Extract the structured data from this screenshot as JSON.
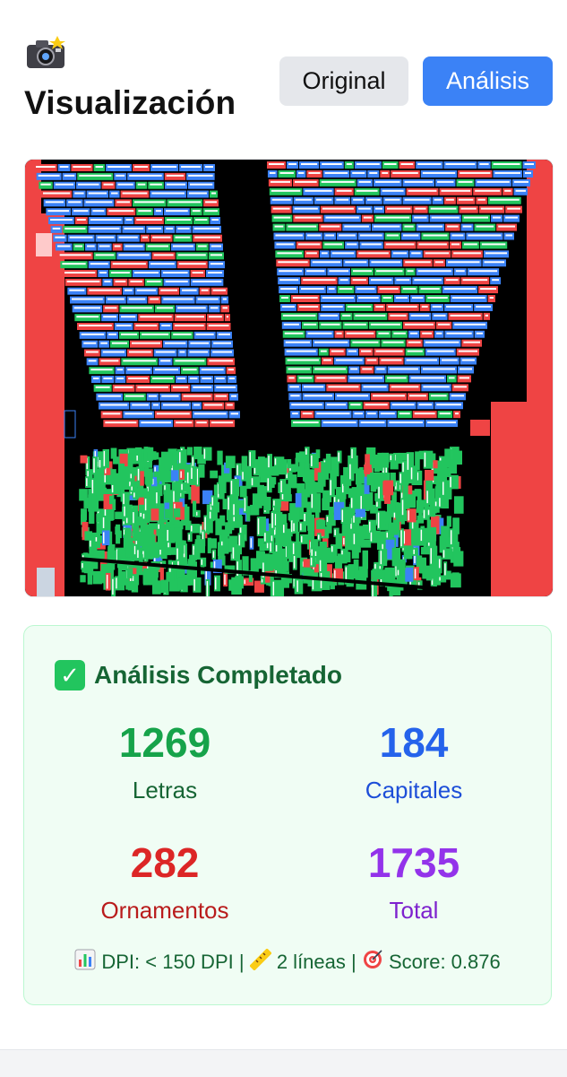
{
  "header": {
    "icon": "camera-flash-icon",
    "title": "Visualización",
    "buttons": {
      "original": "Original",
      "analisis": "Análisis"
    },
    "active_button": "analisis"
  },
  "visualization": {
    "colors": {
      "letters": "#22c55e",
      "capitals": "#3b82f6",
      "ornaments": "#ef4444",
      "background": "#000000"
    }
  },
  "result": {
    "icon": "check-icon",
    "title": "Análisis Completado",
    "stats": [
      {
        "value": "1269",
        "label": "Letras",
        "color": "#16a34a"
      },
      {
        "value": "184",
        "label": "Capitales",
        "color": "#2563eb"
      },
      {
        "value": "282",
        "label": "Ornamentos",
        "color": "#dc2626"
      },
      {
        "value": "1735",
        "label": "Total",
        "color": "#9333ea"
      }
    ],
    "footer": {
      "dpi_icon": "bar-chart-icon",
      "dpi": "DPI: < 150 DPI",
      "sep1": "|",
      "lines_icon": "ruler-icon",
      "lines": "2 líneas",
      "sep2": "|",
      "score_icon": "target-icon",
      "score": "Score: 0.876"
    }
  }
}
